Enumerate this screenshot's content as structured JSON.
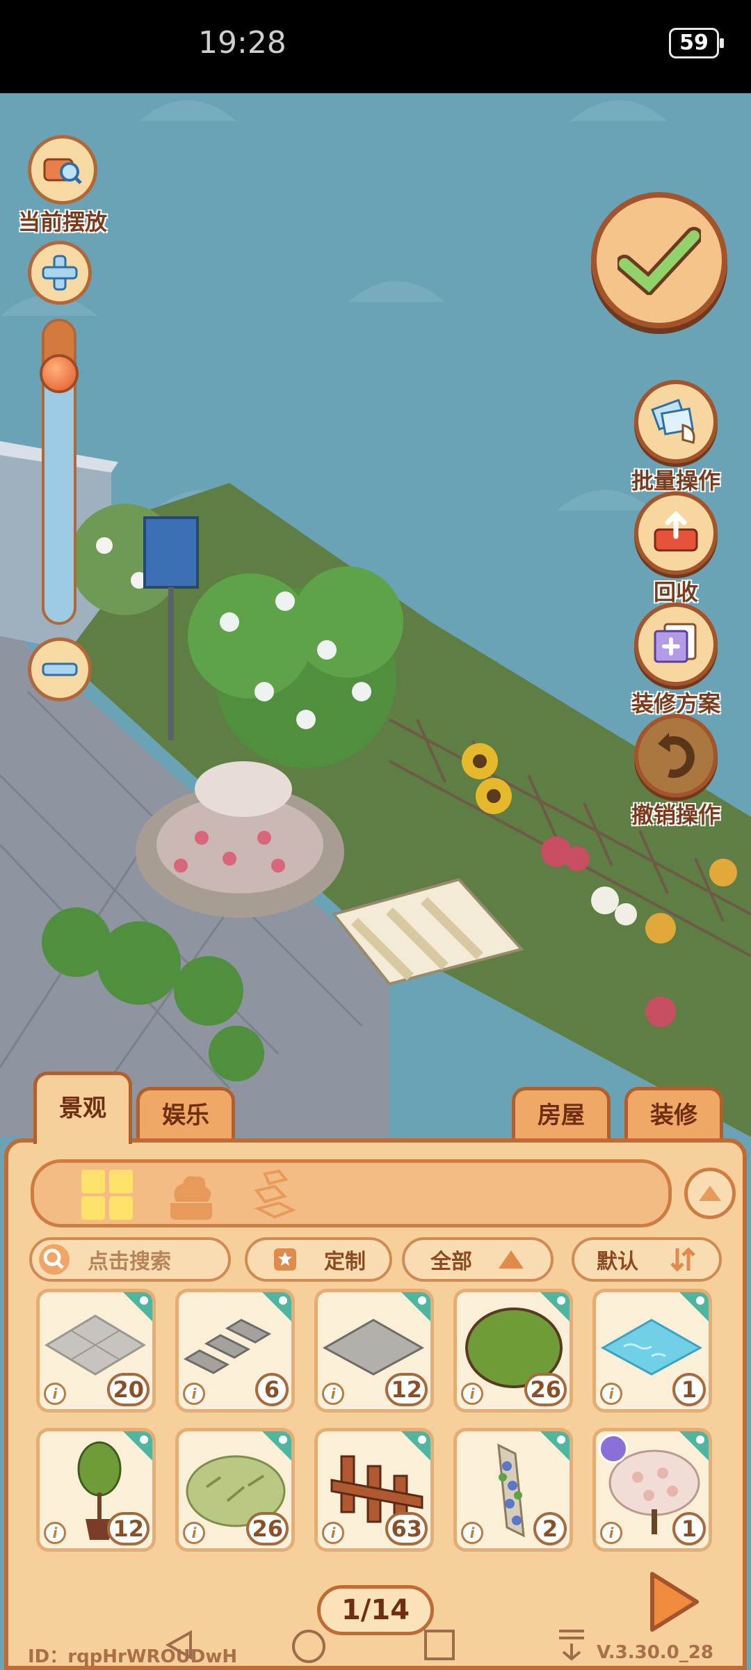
{
  "status_bar": {
    "time": "19:28",
    "battery": "59"
  },
  "left_tools": {
    "current_placed_label": "当前摆放",
    "zoom_level": 0.18
  },
  "right_actions": {
    "batch_label": "批量操作",
    "recycle_label": "回收",
    "plan_label": "装修方案",
    "undo_label": "撤销操作"
  },
  "tabs": {
    "landscape": "景观",
    "entertainment": "娱乐",
    "house": "房屋",
    "decoration": "装修"
  },
  "filters": {
    "search_placeholder": "点击搜索",
    "custom_label": "定制",
    "all_label": "全部",
    "sort_label": "默认"
  },
  "items": [
    {
      "name": "gray-brick-tile",
      "count": "20"
    },
    {
      "name": "stepping-stones",
      "count": "6"
    },
    {
      "name": "stone-slab",
      "count": "12"
    },
    {
      "name": "round-bush",
      "count": "26"
    },
    {
      "name": "water-tile",
      "count": "1"
    },
    {
      "name": "potted-topiary",
      "count": "12"
    },
    {
      "name": "leafy-shrub",
      "count": "26"
    },
    {
      "name": "wooden-fence",
      "count": "63"
    },
    {
      "name": "flower-trellis",
      "count": "2"
    },
    {
      "name": "blossom-tree",
      "count": "1"
    }
  ],
  "pagination": {
    "page": "1/14"
  },
  "footer": {
    "id_text": "ID：rqpHrWROUDwH",
    "version": "V.3.30.0_28"
  },
  "colors": {
    "sky": "#6aa3b5",
    "panel": "#f6cf9b",
    "panel_border": "#c06b34",
    "accent_green": "#4fb59e"
  }
}
